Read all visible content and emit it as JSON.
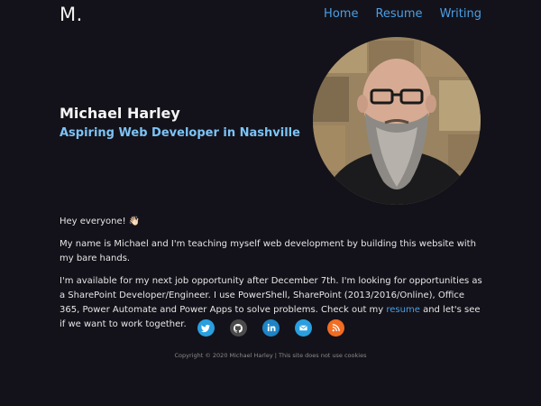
{
  "header": {
    "logo": "M.",
    "nav": [
      {
        "label": "Home"
      },
      {
        "label": "Resume"
      },
      {
        "label": "Writing"
      }
    ]
  },
  "hero": {
    "name": "Michael Harley",
    "tagline": "Aspiring Web Developer in Nashville"
  },
  "content": {
    "greeting": "Hey everyone! 👋🏻",
    "intro": "My name is Michael and I'm teaching myself web development by building this website with my bare hands.",
    "availability_before_link": "I'm available for my next job opportunity after December 7th. I'm looking for opportunities as a SharePoint Developer/Engineer. I use PowerShell, SharePoint (2013/2016/Online), Office 365, Power Automate and Power Apps to solve problems. Check out my ",
    "resume_link": "resume",
    "availability_after_link": " and let's see if we want to work together."
  },
  "social": [
    {
      "icon": "twitter-icon",
      "color": "#2a9fe0"
    },
    {
      "icon": "github-icon",
      "color": "#4b4b4b"
    },
    {
      "icon": "linkedin-icon",
      "color": "#1e84c5"
    },
    {
      "icon": "email-icon",
      "color": "#2a9fe0"
    },
    {
      "icon": "rss-icon",
      "color": "#f26c22"
    }
  ],
  "footer": {
    "text": "Copyright © 2020 Michael Harley | This site does not use cookies"
  },
  "colors": {
    "background": "#13121a",
    "link": "#4a9fe6",
    "tagline": "#7dc3f5"
  }
}
